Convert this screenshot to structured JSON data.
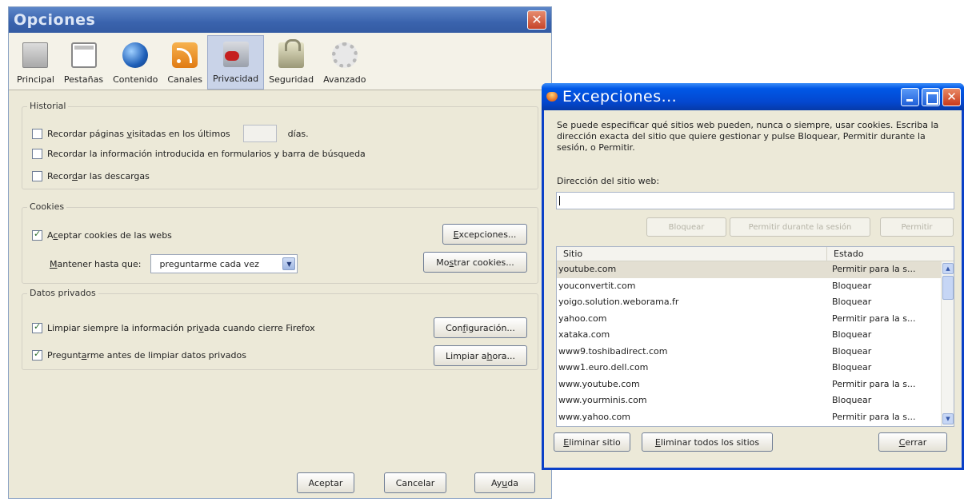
{
  "options_window": {
    "title": "Opciones",
    "close_glyph": "✕",
    "tabs": [
      {
        "label": "Principal",
        "icon": "general-icon"
      },
      {
        "label": "Pestañas",
        "icon": "tabs-icon"
      },
      {
        "label": "Contenido",
        "icon": "globe-icon"
      },
      {
        "label": "Canales",
        "icon": "rss-icon"
      },
      {
        "label": "Privacidad",
        "icon": "privacy-icon"
      },
      {
        "label": "Seguridad",
        "icon": "lock-icon"
      },
      {
        "label": "Avanzado",
        "icon": "gear-icon"
      }
    ],
    "selected_tab": "Privacidad",
    "history": {
      "legend": "Historial",
      "visited_pre": "Recordar páginas ",
      "visited_u": "v",
      "visited_post": "isitadas en los últimos",
      "days_value": "",
      "days_label": "días.",
      "forms_label": "Recordar la información introducida en formularios y barra de búsqueda",
      "downloads_pre": "Recor",
      "downloads_u": "d",
      "downloads_post": "ar las descargas"
    },
    "cookies": {
      "legend": "Cookies",
      "accept_pre": "A",
      "accept_u": "c",
      "accept_post": "eptar cookies de las webs",
      "keep_u": "M",
      "keep_post": "antener hasta que:",
      "keep_select": "preguntarme cada vez",
      "exceptions_u": "E",
      "exceptions_post": "xcepciones...",
      "show_pre": "Mo",
      "show_u": "s",
      "show_post": "trar cookies..."
    },
    "private_data": {
      "legend": "Datos privados",
      "clear_on_close_pre": "Limpiar siempre la información pri",
      "clear_on_close_u": "v",
      "clear_on_close_post": "ada cuando cierre Firefox",
      "ask_pre": "Pregunt",
      "ask_u": "a",
      "ask_post": "rme antes de limpiar datos privados",
      "config_pre": "Con",
      "config_u": "f",
      "config_post": "iguración...",
      "clear_now_pre": "Limpiar a",
      "clear_now_u": "h",
      "clear_now_post": "ora..."
    },
    "footer": {
      "accept": "Aceptar",
      "cancel": "Cancelar",
      "help_pre": "Ay",
      "help_u": "u",
      "help_post": "da"
    }
  },
  "exceptions_window": {
    "title": "Excepciones...",
    "description": "Se puede especificar qué sitios web pueden, nunca o siempre, usar cookies. Escriba la dirección exacta del sitio que quiere gestionar y pulse Bloquear, Permitir durante la sesión, o Permitir.",
    "address_label": "Dirección del sitio web:",
    "address_value": "",
    "buttons": {
      "block": "Bloquear",
      "allow_session": "Permitir durante la sesión",
      "allow": "Permitir"
    },
    "columns": {
      "site": "Sitio",
      "status": "Estado"
    },
    "rows": [
      {
        "site": "youtube.com",
        "status": "Permitir para la s..."
      },
      {
        "site": "youconvertit.com",
        "status": "Bloquear"
      },
      {
        "site": "yoigo.solution.weborama.fr",
        "status": "Bloquear"
      },
      {
        "site": "yahoo.com",
        "status": "Permitir para la s..."
      },
      {
        "site": "xataka.com",
        "status": "Bloquear"
      },
      {
        "site": "www9.toshibadirect.com",
        "status": "Bloquear"
      },
      {
        "site": "www1.euro.dell.com",
        "status": "Bloquear"
      },
      {
        "site": "www.youtube.com",
        "status": "Permitir para la s..."
      },
      {
        "site": "www.yourminis.com",
        "status": "Bloquear"
      },
      {
        "site": "www.yahoo.com",
        "status": "Permitir para la s..."
      }
    ],
    "footer": {
      "remove_u": "E",
      "remove_post": "liminar sitio",
      "remove_all_u": "E",
      "remove_all_post": "liminar todos los sitios",
      "close_u": "C",
      "close_post": "errar"
    }
  }
}
